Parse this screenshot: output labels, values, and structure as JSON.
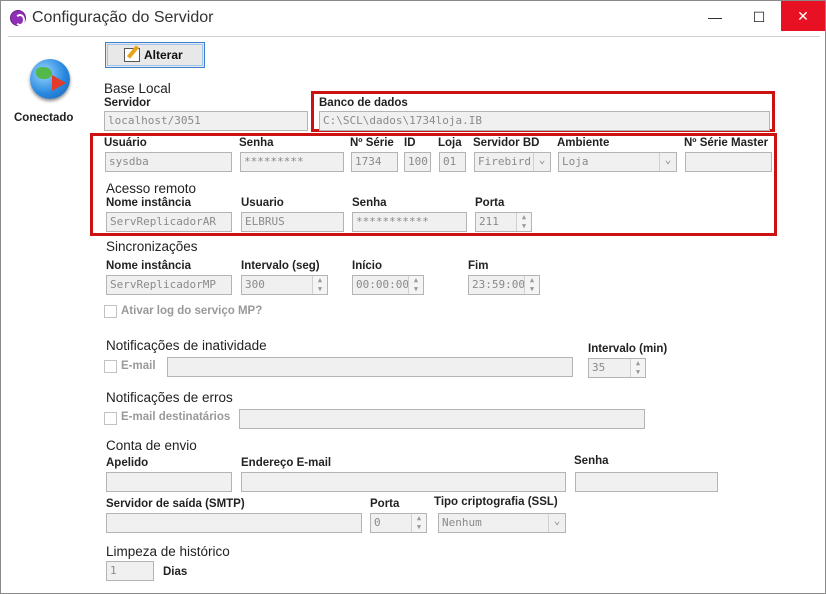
{
  "window": {
    "title": "Configuração do Servidor",
    "minimize_glyph": "—",
    "maximize_glyph": "☐",
    "close_glyph": "✕"
  },
  "toolbar": {
    "alter_label": "Alterar"
  },
  "status": {
    "text": "Conectado"
  },
  "base_local": {
    "section": "Base Local",
    "servidor_label": "Servidor",
    "servidor_value": "localhost/3051",
    "banco_label": "Banco de dados",
    "banco_value": "C:\\SCL\\dados\\1734loja.IB"
  },
  "conn": {
    "usuario_label": "Usuário",
    "usuario_value": "sysdba",
    "senha_label": "Senha",
    "senha_value": "*********",
    "serie_label": "Nº Série",
    "serie_value": "1734",
    "id_label": "ID",
    "id_value": "100",
    "loja_label": "Loja",
    "loja_value": "01",
    "servidor_bd_label": "Servidor BD",
    "servidor_bd_value": "Firebird",
    "ambiente_label": "Ambiente",
    "ambiente_value": "Loja",
    "serie_master_label": "Nº Série Master",
    "serie_master_value": ""
  },
  "remote": {
    "section": "Acesso remoto",
    "instancia_label": "Nome instância",
    "instancia_value": "ServReplicadorAR",
    "usuario_label": "Usuario",
    "usuario_value": "ELBRUS",
    "senha_label": "Senha",
    "senha_value": "***********",
    "porta_label": "Porta",
    "porta_value": "211"
  },
  "sync": {
    "section": "Sincronizações",
    "instancia_label": "Nome instância",
    "instancia_value": "ServReplicadorMP",
    "intervalo_label": "Intervalo (seg)",
    "intervalo_value": "300",
    "inicio_label": "Início",
    "inicio_value": "00:00:00",
    "fim_label": "Fim",
    "fim_value": "23:59:00",
    "log_label": "Ativar log do serviço MP?"
  },
  "inactivity": {
    "section": "Notificações de inatividade",
    "email_label": "E-mail",
    "email_value": "",
    "intervalo_label": "Intervalo (min)",
    "intervalo_value": "35"
  },
  "errors": {
    "section": "Notificações de erros",
    "email_label": "E-mail destinatários",
    "email_value": ""
  },
  "account": {
    "section": "Conta de envio",
    "apelido_label": "Apelido",
    "apelido_value": "",
    "endereco_label": "Endereço E-mail",
    "endereco_value": "",
    "senha_label": "Senha",
    "senha_value": "",
    "smtp_label": "Servidor de saída (SMTP)",
    "smtp_value": "",
    "porta_label": "Porta",
    "porta_value": "0",
    "cripto_label": "Tipo criptografia (SSL)",
    "cripto_value": "Nenhum"
  },
  "history": {
    "section": "Limpeza de histórico",
    "dias_value": "1",
    "dias_label": "Dias"
  },
  "icons": {
    "app": "app-logo-icon",
    "alter": "edit-pencil-icon",
    "status": "globe-connected-icon",
    "spinner": "spinner-arrows-icon",
    "dropdown": "chevron-down-icon"
  },
  "colors": {
    "highlight_box": "#cc1111",
    "close_button": "#e81123",
    "disabled_field_bg": "#f0f0f0",
    "disabled_text": "#8a8a8a"
  }
}
